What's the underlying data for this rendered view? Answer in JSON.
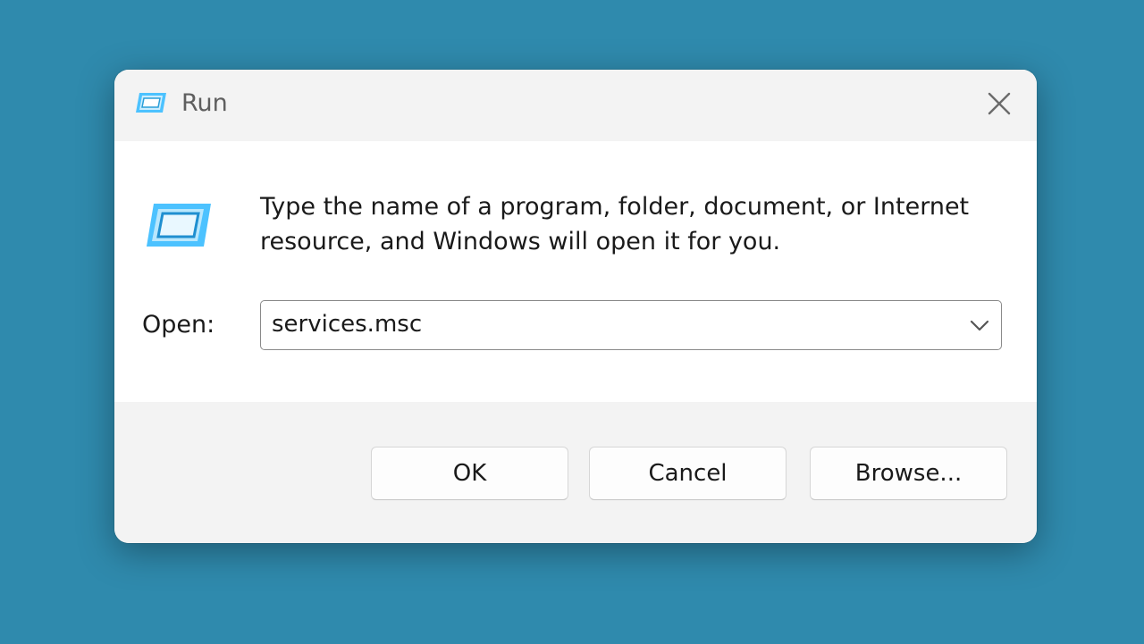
{
  "window": {
    "title": "Run",
    "icon": "run-icon",
    "close_icon": "close-icon"
  },
  "content": {
    "message": "Type the name of a program, folder, document, or Internet resource, and Windows will open it for you.",
    "open_label": "Open:",
    "open_value": "services.msc"
  },
  "buttons": {
    "ok": "OK",
    "cancel": "Cancel",
    "browse": "Browse..."
  },
  "colors": {
    "desktop": "#2f8aad",
    "accent_icon": "#4cc2ff"
  }
}
